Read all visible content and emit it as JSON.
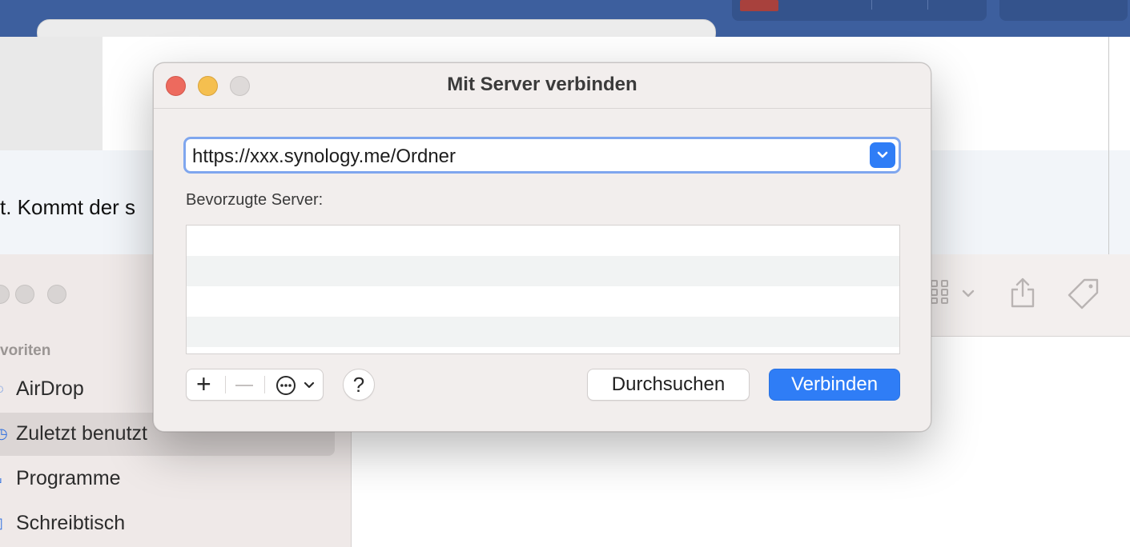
{
  "dialog": {
    "title": "Mit Server verbinden",
    "server_address": "https://xxx.synology.me/Ordner",
    "favorites_label": "Bevorzugte Server:",
    "favorite_servers": [],
    "add_symbol": "+",
    "help_symbol": "?",
    "browse_label": "Durchsuchen",
    "connect_label": "Verbinden",
    "accent_color": "#2f7df6"
  },
  "background": {
    "document_text": "t. Kommt der s",
    "finder_sidebar": {
      "section_header": "voriten",
      "items": [
        {
          "label": "AirDrop",
          "icon": "airdrop-icon"
        },
        {
          "label": "Zuletzt benutzt",
          "icon": "clock-icon",
          "selected": true
        },
        {
          "label": "Programme",
          "icon": "apps-icon"
        },
        {
          "label": "Schreibtisch",
          "icon": "desktop-icon"
        }
      ]
    }
  }
}
